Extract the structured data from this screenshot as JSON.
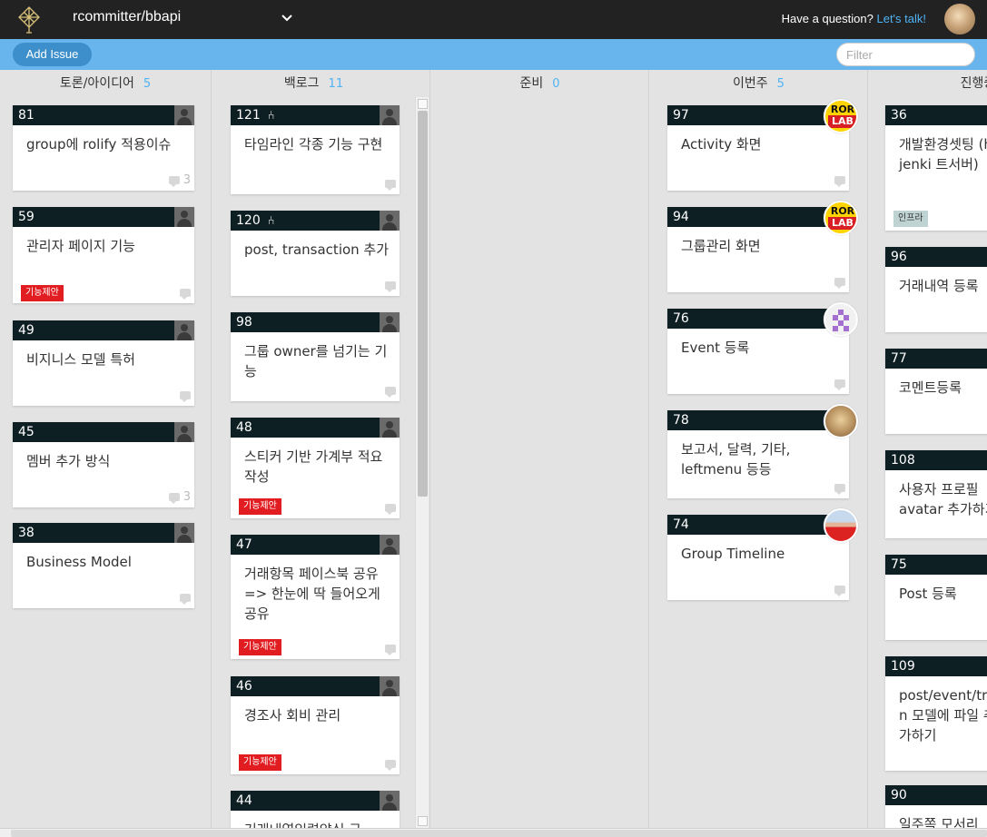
{
  "header": {
    "repo_name": "rcommitter/bbapi",
    "question_text": "Have a question?",
    "question_link": "Let's talk!"
  },
  "toolbar": {
    "add_issue_label": "Add Issue",
    "filter_placeholder": "Filter"
  },
  "columns": [
    {
      "title": "토론/아이디어",
      "count": "5",
      "cards": [
        {
          "number": "81",
          "title": "group에 rolify 적용이슈",
          "comments": "3"
        },
        {
          "number": "59",
          "title": "관리자 페이지 기능",
          "label": "기능제안"
        },
        {
          "number": "49",
          "title": "비지니스 모델 특허"
        },
        {
          "number": "45",
          "title": "멤버 추가 방식",
          "comments": "3"
        },
        {
          "number": "38",
          "title": "Business Model"
        }
      ]
    },
    {
      "title": "백로그",
      "count": "11",
      "cards": [
        {
          "number": "121",
          "title": "타임라인 각종 기능 구현",
          "pull": true
        },
        {
          "number": "120",
          "title": "post, transaction 추가",
          "pull": true
        },
        {
          "number": "98",
          "title": "그룹 owner를 넘기는 기능"
        },
        {
          "number": "48",
          "title": "스티커 기반 가계부 적요 작성",
          "label": "기능제안"
        },
        {
          "number": "47",
          "title": "거래항목 페이스북 공유 => 한눈에 딱 들어오게 공유",
          "label": "기능제안"
        },
        {
          "number": "46",
          "title": "경조사 회비 관리",
          "label": "기능제안"
        },
        {
          "number": "44",
          "title": "거래내역입력양식 구"
        }
      ]
    },
    {
      "title": "준비",
      "count": "0",
      "cards": []
    },
    {
      "title": "이번주",
      "count": "5",
      "cards": [
        {
          "number": "97",
          "title": "Activity 화면",
          "avatar": "rorlab"
        },
        {
          "number": "94",
          "title": "그룹관리 화면",
          "avatar": "rorlab"
        },
        {
          "number": "76",
          "title": "Event 등록",
          "avatar": "pixel"
        },
        {
          "number": "78",
          "title": "보고서, 달력, 기타, leftmenu 등등",
          "avatar": "sand"
        },
        {
          "number": "74",
          "title": "Group Timeline",
          "avatar": "person"
        }
      ]
    },
    {
      "title": "진행중",
      "cards": [
        {
          "number": "36",
          "title": "개발환경셋팅 (huboard, jenki 트서버)",
          "label": "인프라"
        },
        {
          "number": "96",
          "title": "거래내역 등록"
        },
        {
          "number": "77",
          "title": "코멘트등록"
        },
        {
          "number": "108",
          "title": "사용자 프로필 avatar 추가하기"
        },
        {
          "number": "75",
          "title": "Post 등록"
        },
        {
          "number": "109",
          "title": "post/event/tra n 모델에 파일 추가하기"
        },
        {
          "number": "90",
          "title": "일주쪽 모서리"
        }
      ]
    }
  ],
  "rorlab_top": "ROR",
  "rorlab_bottom": "LAB"
}
